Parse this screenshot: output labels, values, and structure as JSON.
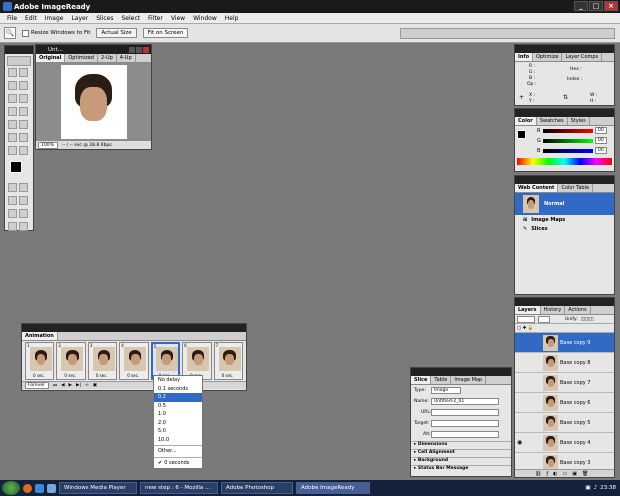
{
  "app": {
    "title": "Adobe ImageReady"
  },
  "menu": [
    "File",
    "Edit",
    "Image",
    "Layer",
    "Slices",
    "Select",
    "Filter",
    "View",
    "Window",
    "Help"
  ],
  "options": {
    "resize_label": "Resize Windows to Fit",
    "actual_size": "Actual Size",
    "fit_on_screen": "Fit on Screen"
  },
  "doc": {
    "title": "Unt...",
    "tabs": [
      "Original",
      "Optimized",
      "2-Up",
      "4-Up"
    ],
    "zoom": "100%",
    "status": "-- / -- sec @ 28.8 Kbps"
  },
  "info": {
    "tabs": [
      "Info",
      "Optimize",
      "Layer Comps"
    ],
    "labels": [
      "R :",
      "G :",
      "B :",
      "Op :",
      "Hex :",
      "Index :",
      "X :",
      "Y :",
      "W :",
      "H :"
    ]
  },
  "color": {
    "tabs": [
      "Color",
      "Swatches",
      "Styles"
    ],
    "channels": [
      {
        "name": "R",
        "value": "00"
      },
      {
        "name": "G",
        "value": "00"
      },
      {
        "name": "B",
        "value": "00"
      }
    ]
  },
  "webcontent": {
    "tabs": [
      "Web Content",
      "Color Table"
    ],
    "items": [
      {
        "label": "Normal"
      },
      {
        "label": "Image Maps"
      },
      {
        "label": "Slices"
      }
    ]
  },
  "animation": {
    "tab": "Animation",
    "frames": [
      {
        "num": "1",
        "delay": "0 sec."
      },
      {
        "num": "2",
        "delay": "0 sec."
      },
      {
        "num": "3",
        "delay": "0 sec."
      },
      {
        "num": "4",
        "delay": "0 sec."
      },
      {
        "num": "5",
        "delay": "0 sec."
      },
      {
        "num": "6",
        "delay": "0 sec."
      },
      {
        "num": "7",
        "delay": "0 sec."
      }
    ],
    "loop": "Forever"
  },
  "delay_menu": [
    "No delay",
    "0.1 seconds",
    "0.2",
    "0.5",
    "1.0",
    "2.0",
    "5.0",
    "10.0",
    "Other...",
    "0 seconds"
  ],
  "slice": {
    "tabs": [
      "Slice",
      "Table",
      "Image Map"
    ],
    "type_label": "Type:",
    "type_value": "Image",
    "name_label": "Name:",
    "name_value": "Untitled-2_01",
    "url_label": "URL:",
    "target_label": "Target:",
    "alt_label": "Alt:",
    "sections": [
      "Dimensions",
      "Cell Alignment",
      "Background",
      "Status Bar Message"
    ]
  },
  "layers": {
    "tabs": [
      "Layers",
      "History",
      "Actions"
    ],
    "unify": "Unify:",
    "rows": [
      "Base copy 9",
      "Base copy 8",
      "Base copy 7",
      "Base copy 6",
      "Base copy 5",
      "Base copy 4",
      "Base copy 3"
    ]
  },
  "taskbar": {
    "tasks": [
      "Windows Media Player",
      "new step : 6 - Mozilla ...",
      "Adobe Photoshop",
      "Adobe ImageReady"
    ],
    "clock": "23:38"
  }
}
